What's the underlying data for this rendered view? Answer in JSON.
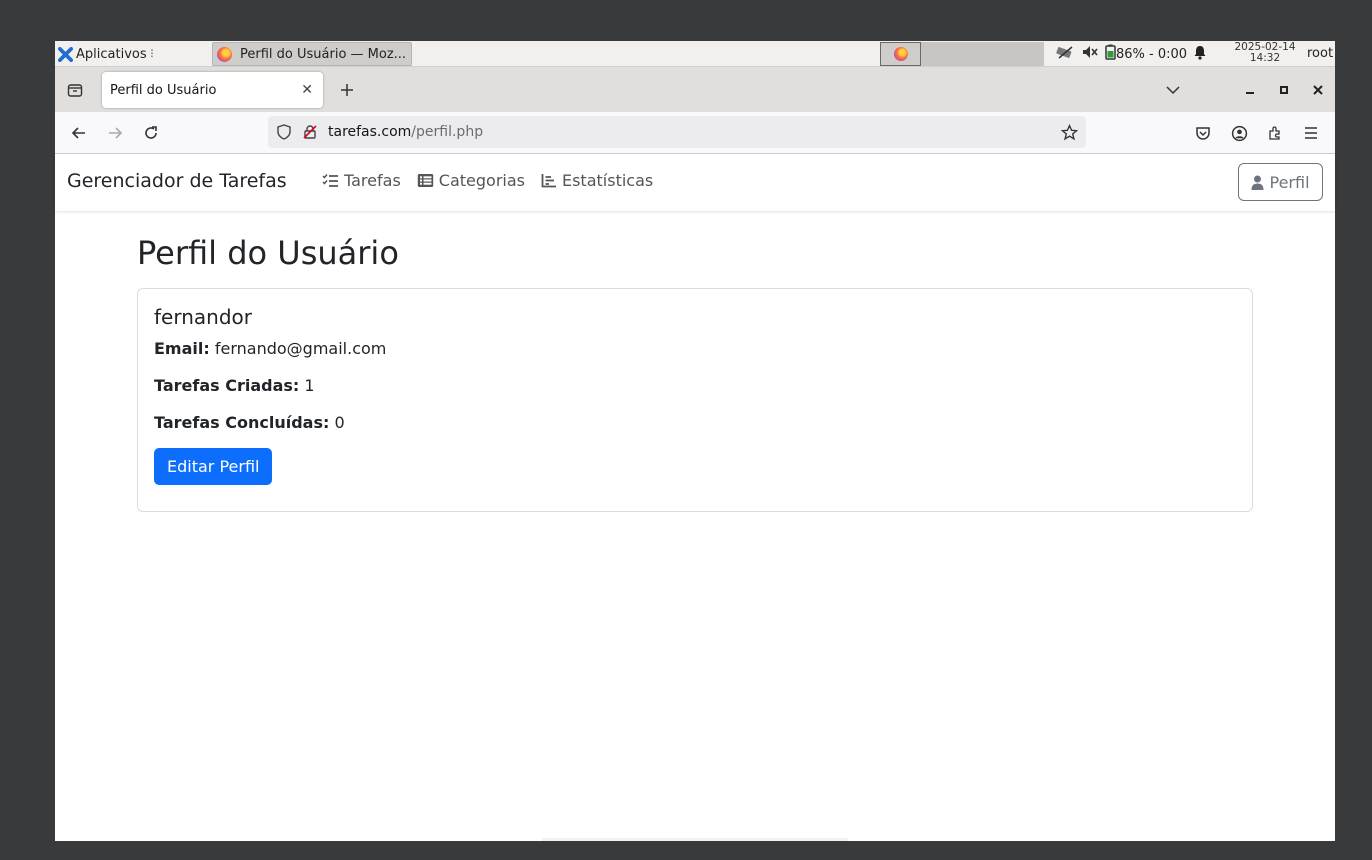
{
  "panel": {
    "apps_label": "Aplicativos",
    "task_title": "Perfil do Usuário — Moz...",
    "battery": "86% - 0:00",
    "date": "2025-02-14",
    "time": "14:32",
    "user": "root"
  },
  "browser": {
    "tab_title": "Perfil do Usuário",
    "url_host": "tarefas.com",
    "url_path": "/perfil.php"
  },
  "app": {
    "brand": "Gerenciador de Tarefas",
    "nav": {
      "tarefas": "Tarefas",
      "categorias": "Categorias",
      "estatisticas": "Estatísticas"
    },
    "perfil_button": "Perfil"
  },
  "profile": {
    "page_title": "Perfil do Usuário",
    "username": "fernandor",
    "email_label": "Email:",
    "email": "fernando@gmail.com",
    "created_label": "Tarefas Criadas:",
    "created": "1",
    "done_label": "Tarefas Concluídas:",
    "done": "0",
    "edit_button": "Editar Perfil"
  },
  "colors": {
    "primary": "#0d6efd",
    "secondary": "#6c757d"
  }
}
